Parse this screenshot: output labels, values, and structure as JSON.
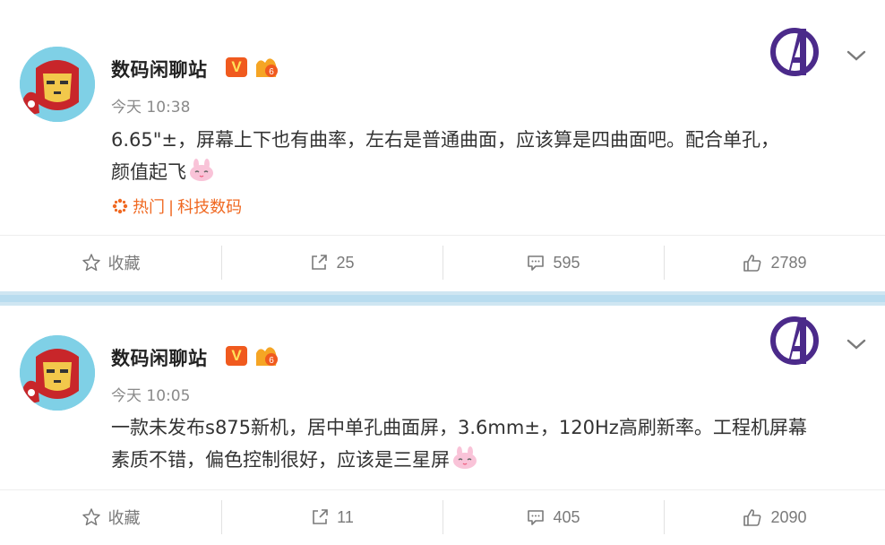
{
  "posts": [
    {
      "username": "数码闲聊站",
      "vip_badge": "V",
      "time": "今天 10:38",
      "content_line1": "6.65\"±，屏幕上下也有曲率，左右是普通曲面，应该算是四曲面吧。配合单孔，",
      "content_line2": "颜值起飞",
      "topic_hot": "热门",
      "topic_sep": "|",
      "topic_category": "科技数码",
      "actions": {
        "favorite": "收藏",
        "repost": "25",
        "comment": "595",
        "like": "2789"
      }
    },
    {
      "username": "数码闲聊站",
      "vip_badge": "V",
      "time": "今天 10:05",
      "content_line1": "一款未发布s875新机，居中单孔曲面屏，3.6mm±，120Hz高刷新率。工程机屏幕",
      "content_line2": "素质不错，偏色控制很好，应该是三星屏",
      "actions": {
        "favorite": "收藏",
        "repost": "11",
        "comment": "405",
        "like": "2090"
      }
    }
  ],
  "icons": {
    "avatar": "iron-man-avatar",
    "brand": "avengers-logo-icon",
    "menu": "chevron-down-icon",
    "emoji": "pink-bunny-emoji",
    "favorite": "star-icon",
    "repost": "share-icon",
    "comment": "comment-icon",
    "like": "thumbs-up-icon",
    "hot": "hot-spark-icon"
  },
  "colors": {
    "accent_orange": "#f06922",
    "vip_badge_bg": "#f05a1e",
    "separator": "#cfe6f2",
    "avengers_purple": "#4b2a8a"
  }
}
